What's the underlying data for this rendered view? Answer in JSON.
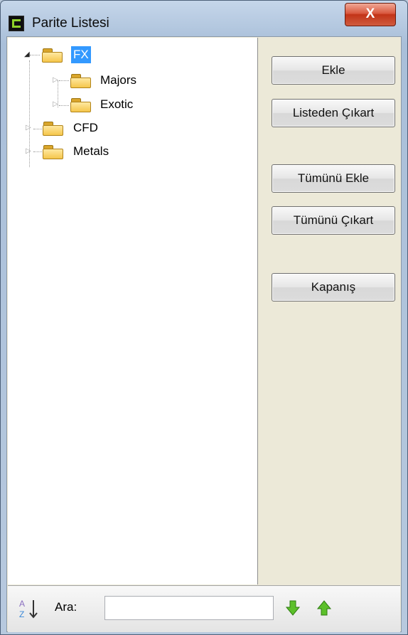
{
  "window": {
    "title": "Parite Listesi",
    "close_label": "X"
  },
  "tree": {
    "nodes": [
      {
        "label": "FX",
        "expanded": true,
        "selected": true
      },
      {
        "label": "Majors",
        "expanded": false,
        "selected": false
      },
      {
        "label": "Exotic",
        "expanded": false,
        "selected": false
      },
      {
        "label": "CFD",
        "expanded": false,
        "selected": false
      },
      {
        "label": "Metals",
        "expanded": false,
        "selected": false
      }
    ]
  },
  "buttons": {
    "add": "Ekle",
    "remove_from_list": "Listeden Çıkart",
    "add_all": "Tümünü Ekle",
    "remove_all": "Tümünü Çıkart",
    "close": "Kapanış"
  },
  "search": {
    "label": "Ara:",
    "value": "",
    "placeholder": ""
  },
  "icons": {
    "sort": "sort-az-icon",
    "next": "arrow-down-icon",
    "previous": "arrow-up-icon"
  },
  "colors": {
    "selection": "#3399ff",
    "arrow_green": "#4caf1e",
    "close_red": "#c23418"
  }
}
